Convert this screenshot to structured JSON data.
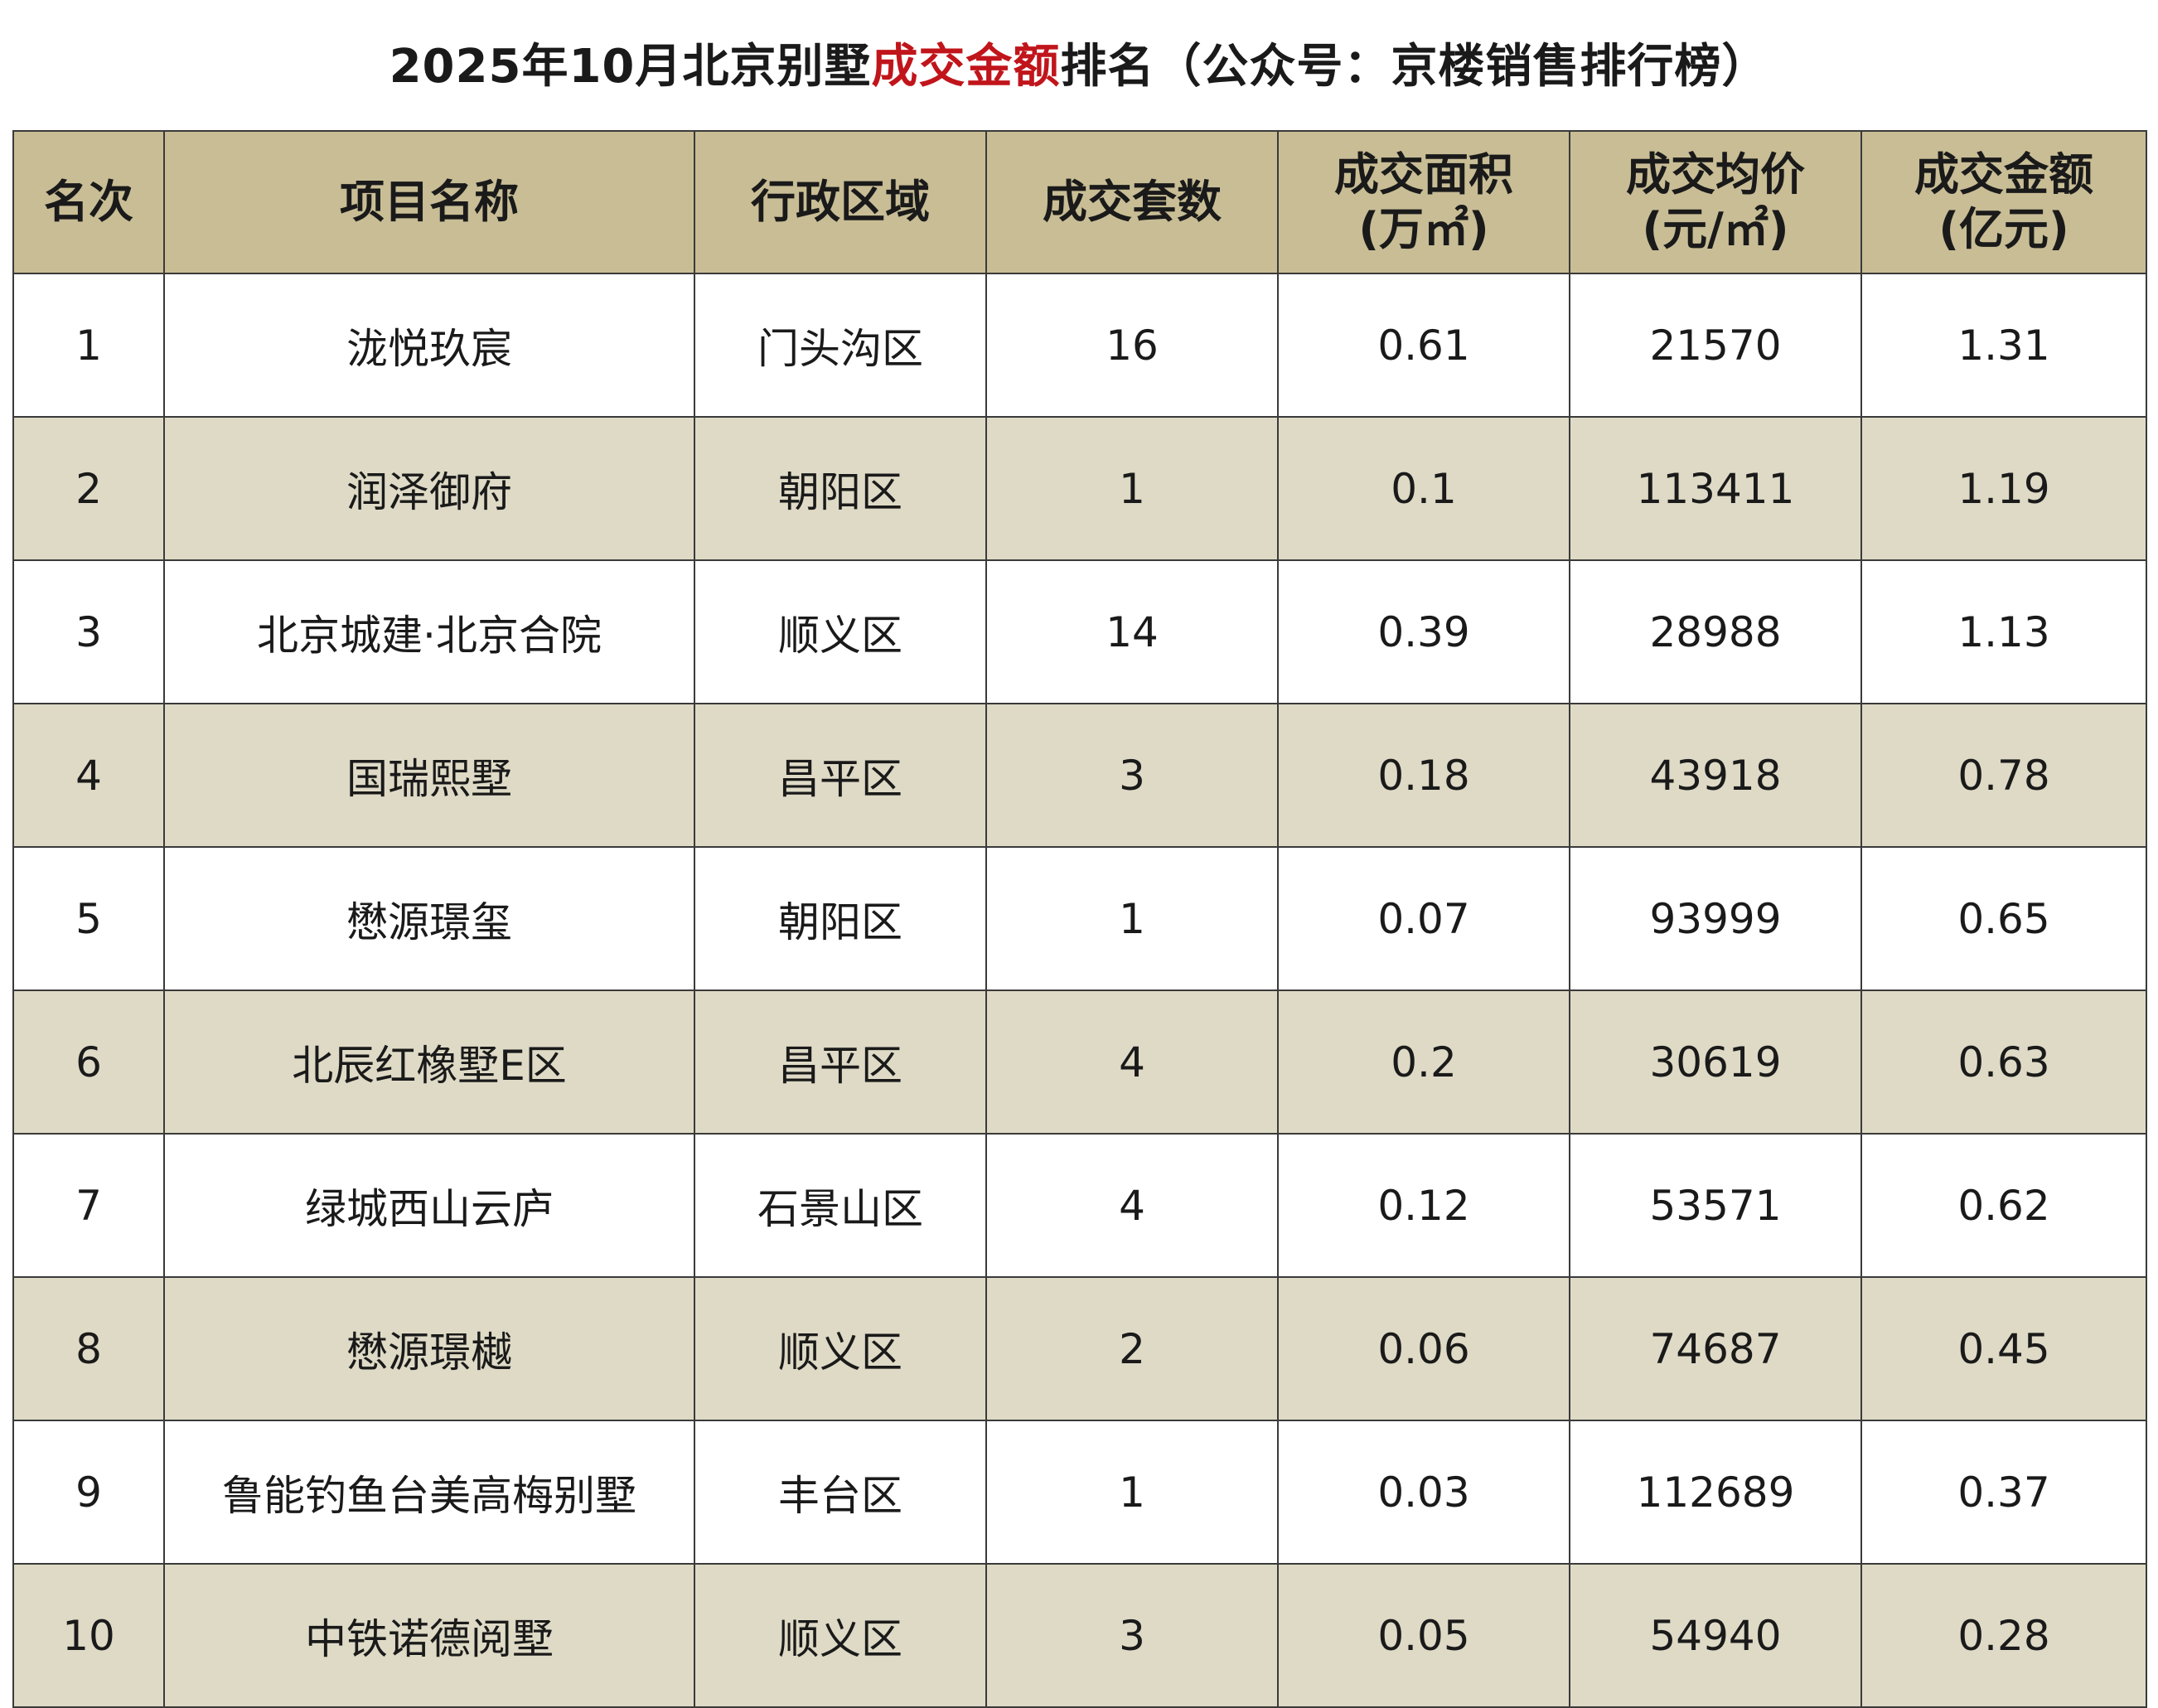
{
  "title": {
    "prefix": "2025年10月北京别墅",
    "highlight": "成交金额",
    "suffix": "排名（公众号：京楼销售排行榜）"
  },
  "columns": [
    {
      "line1": "名次",
      "line2": ""
    },
    {
      "line1": "项目名称",
      "line2": ""
    },
    {
      "line1": "行政区域",
      "line2": ""
    },
    {
      "line1": "成交套数",
      "line2": ""
    },
    {
      "line1": "成交面积",
      "line2": "(万㎡)"
    },
    {
      "line1": "成交均价",
      "line2": "(元/㎡)"
    },
    {
      "line1": "成交金额",
      "line2": "(亿元)"
    }
  ],
  "rows": [
    [
      "1",
      "泷悦玖宸",
      "门头沟区",
      "16",
      "0.61",
      "21570",
      "1.31"
    ],
    [
      "2",
      "润泽御府",
      "朝阳区",
      "1",
      "0.1",
      "113411",
      "1.19"
    ],
    [
      "3",
      "北京城建·北京合院",
      "顺义区",
      "14",
      "0.39",
      "28988",
      "1.13"
    ],
    [
      "4",
      "国瑞熙墅",
      "昌平区",
      "3",
      "0.18",
      "43918",
      "0.78"
    ],
    [
      "5",
      "懋源璟玺",
      "朝阳区",
      "1",
      "0.07",
      "93999",
      "0.65"
    ],
    [
      "6",
      "北辰红橡墅E区",
      "昌平区",
      "4",
      "0.2",
      "30619",
      "0.63"
    ],
    [
      "7",
      "绿城西山云庐",
      "石景山区",
      "4",
      "0.12",
      "53571",
      "0.62"
    ],
    [
      "8",
      "懋源璟樾",
      "顺义区",
      "2",
      "0.06",
      "74687",
      "0.45"
    ],
    [
      "9",
      "鲁能钓鱼台美高梅别墅",
      "丰台区",
      "1",
      "0.03",
      "112689",
      "0.37"
    ],
    [
      "10",
      "中铁诺德阅墅",
      "顺义区",
      "3",
      "0.05",
      "54940",
      "0.28"
    ]
  ],
  "colors": {
    "header_bg": "#c8bd95",
    "stripe_bg": "#dedac6",
    "highlight": "#c0151b",
    "border": "#3a3a3a"
  }
}
